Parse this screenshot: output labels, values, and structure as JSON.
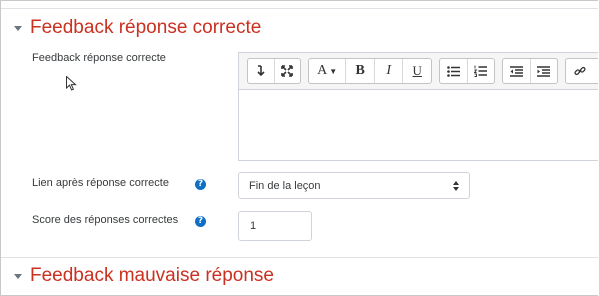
{
  "section_correct": {
    "title": "Feedback réponse correcte"
  },
  "feedback_editor": {
    "label": "Feedback réponse correcte",
    "toolbar": {
      "group1": [
        "toggle-toolbar-icon",
        "fullscreen-icon"
      ],
      "group2": [
        "font-color-icon",
        "bold-icon",
        "italic-icon",
        "underline-icon"
      ],
      "group3": [
        "bulleted-list-icon",
        "numbered-list-icon"
      ],
      "group4": [
        "outdent-icon",
        "indent-icon"
      ],
      "group5": [
        "link-icon"
      ],
      "font_label": "A",
      "bold_label": "B",
      "italic_label": "I",
      "underline_label": "U"
    },
    "content": ""
  },
  "jump_field": {
    "label": "Lien après réponse correcte",
    "selected": "Fin de la leçon",
    "help_icon": "question-circle-icon"
  },
  "score_field": {
    "label": "Score des réponses correctes",
    "value": "1",
    "help_icon": "question-circle-icon"
  },
  "section_wrong": {
    "title": "Feedback mauvaise réponse"
  },
  "colors": {
    "accent": "#ca3120",
    "help": "#0f6fc5",
    "border": "#ced4da"
  }
}
